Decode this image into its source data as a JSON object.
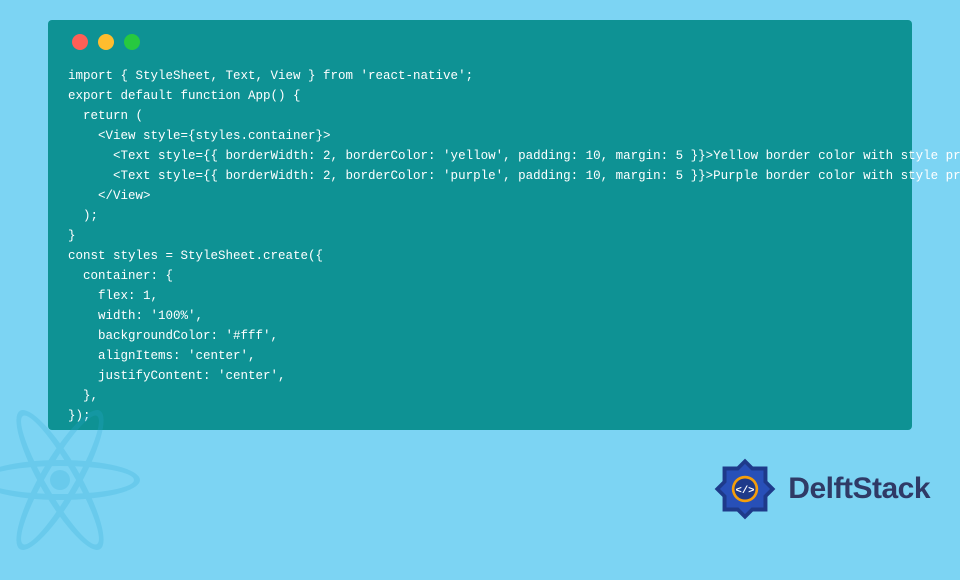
{
  "code": {
    "lines": [
      "import { StyleSheet, Text, View } from 'react-native';",
      "export default function App() {",
      "  return (",
      "    <View style={styles.container}>",
      "      <Text style={{ borderWidth: 2, borderColor: 'yellow', padding: 10, margin: 5 }}>Yellow border color with style prop</Text>",
      "      <Text style={{ borderWidth: 2, borderColor: 'purple', padding: 10, margin: 5 }}>Purple border color with style prop</Text>",
      "    </View>",
      "  );",
      "}",
      "const styles = StyleSheet.create({",
      "  container: {",
      "    flex: 1,",
      "    width: '100%',",
      "    backgroundColor: '#fff',",
      "    alignItems: 'center',",
      "    justifyContent: 'center',",
      "  },",
      "});"
    ]
  },
  "brand": {
    "name": "DelftStack"
  },
  "colors": {
    "page_bg": "#7cd4f3",
    "panel_bg": "#0e9294",
    "dot_red": "#ff5f56",
    "dot_yellow": "#ffbd2e",
    "dot_green": "#27c93f",
    "brand_text": "#2f3a66",
    "brand_logo_primary": "#1e3a8a",
    "brand_logo_accent": "#f59e0b"
  }
}
